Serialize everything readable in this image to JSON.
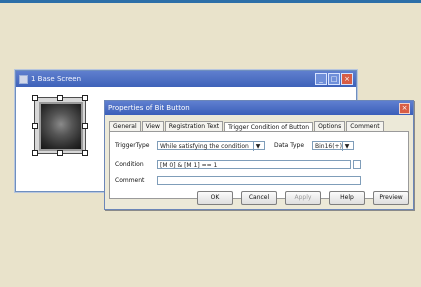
{
  "base_window": {
    "title": "1 Base Screen",
    "buttons": {
      "min": "_",
      "max": "□",
      "close": "×"
    }
  },
  "dialog": {
    "title": "Properties of Bit Button",
    "close": "×",
    "tabs": [
      "General",
      "View",
      "Registration Text",
      "Trigger Condition of Button",
      "Options",
      "Comment"
    ],
    "active_tab_index": 3,
    "fields": {
      "trigger_type_label": "TriggerType",
      "trigger_type_value": "While satisfying the condition",
      "data_type_label": "Data Type",
      "data_type_value": "Bin16(+)",
      "condition_label": "Condition",
      "condition_value": "[M 0] & [M 1] == 1",
      "comment_label": "Comment",
      "comment_value": ""
    },
    "buttons": {
      "ok": "OK",
      "cancel": "Cancel",
      "apply": "Apply",
      "help": "Help",
      "preview": "Preview"
    }
  }
}
